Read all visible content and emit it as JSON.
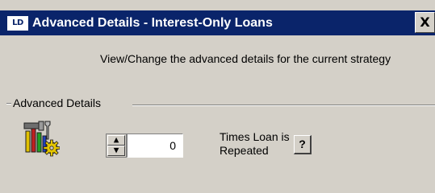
{
  "window": {
    "app_icon_text": "LD",
    "title": "Advanced Details - Interest-Only Loans",
    "close_label": "X"
  },
  "description": "View/Change the advanced details for the current strategy",
  "group": {
    "label": "Advanced Details"
  },
  "field": {
    "value": "0",
    "label": "Times Loan is Repeated",
    "spin_up": "▲",
    "spin_down": "▼",
    "help_label": "?"
  },
  "icons": {
    "app": "app-logo-icon",
    "tools": "tools-gear-icon"
  },
  "colors": {
    "titlebar": "#0a246a",
    "face": "#d4d0c8"
  }
}
